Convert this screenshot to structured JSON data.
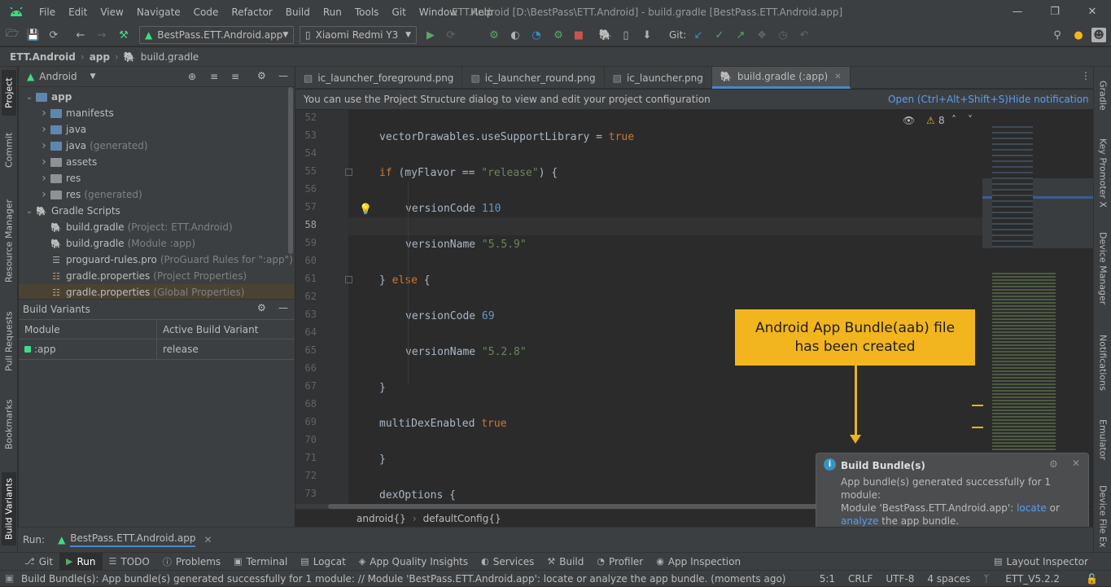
{
  "app_icon": "android-icon",
  "menu": [
    "File",
    "Edit",
    "View",
    "Navigate",
    "Code",
    "Refactor",
    "Build",
    "Run",
    "Tools",
    "Git",
    "Window",
    "Help"
  ],
  "window_title": "ETT.Android [D:\\BestPass\\ETT.Android] - build.gradle [BestPass.ETT.Android.app]",
  "toolbar": {
    "run_config": "BestPass.ETT.Android.app",
    "device": "Xiaomi Redmi Y3",
    "git_label": "Git:"
  },
  "breadcrumb": [
    "ETT.Android",
    "app",
    "build.gradle"
  ],
  "project_panel": {
    "view_mode": "Android",
    "tree": [
      {
        "label": "app",
        "sub": "",
        "level": 0,
        "icon": "folder",
        "open": true,
        "bold": true
      },
      {
        "label": "manifests",
        "sub": "",
        "level": 1,
        "icon": "folder",
        "open": false
      },
      {
        "label": "java",
        "sub": "",
        "level": 1,
        "icon": "folder",
        "open": false
      },
      {
        "label": "java",
        "sub": "(generated)",
        "level": 1,
        "icon": "folder",
        "open": false
      },
      {
        "label": "assets",
        "sub": "",
        "level": 1,
        "icon": "folder-gray",
        "open": false
      },
      {
        "label": "res",
        "sub": "",
        "level": 1,
        "icon": "folder-gray",
        "open": false
      },
      {
        "label": "res",
        "sub": "(generated)",
        "level": 1,
        "icon": "folder-gray",
        "open": false
      },
      {
        "label": "Gradle Scripts",
        "sub": "",
        "level": 0,
        "icon": "gradle",
        "open": true
      },
      {
        "label": "build.gradle",
        "sub": "(Project: ETT.Android)",
        "level": 1,
        "icon": "gradle",
        "open": null
      },
      {
        "label": "build.gradle",
        "sub": "(Module :app)",
        "level": 1,
        "icon": "gradle",
        "open": null
      },
      {
        "label": "proguard-rules.pro",
        "sub": "(ProGuard Rules for \":app\")",
        "level": 1,
        "icon": "file",
        "open": null
      },
      {
        "label": "gradle.properties",
        "sub": "(Project Properties)",
        "level": 1,
        "icon": "props",
        "open": null
      },
      {
        "label": "gradle.properties",
        "sub": "(Global Properties)",
        "level": 1,
        "icon": "props",
        "open": null
      }
    ]
  },
  "build_variants": {
    "title": "Build Variants",
    "col_module": "Module",
    "col_variant": "Active Build Variant",
    "rows": [
      {
        "module": ":app",
        "variant": "release"
      }
    ]
  },
  "left_stripe": [
    "Project",
    "Commit",
    "Resource Manager",
    "Pull Requests",
    "Bookmarks",
    "Build Variants"
  ],
  "right_stripe": [
    "Gradle",
    "Key Promoter X",
    "Device Manager",
    "Notifications",
    "Emulator",
    "Device File Ex"
  ],
  "editor_tabs": [
    {
      "label": "ic_launcher_foreground.png",
      "active": false
    },
    {
      "label": "ic_launcher_round.png",
      "active": false
    },
    {
      "label": "ic_launcher.png",
      "active": false
    },
    {
      "label": "build.gradle (:app)",
      "active": true
    }
  ],
  "notification_bar": {
    "text": "You can use the Project Structure dialog to view and edit your project configuration",
    "open_link": "Open (Ctrl+Alt+Shift+S)",
    "hide_link": "Hide notification"
  },
  "inspections": {
    "warnings": "8"
  },
  "code_lines": [
    {
      "n": "52",
      "indent": 0,
      "parts": []
    },
    {
      "n": "53",
      "indent": 1,
      "parts": [
        [
          "t",
          "vectorDrawables.useSupportLibrary = "
        ],
        [
          "k",
          "true"
        ]
      ]
    },
    {
      "n": "54",
      "indent": 0,
      "parts": []
    },
    {
      "n": "55",
      "indent": 1,
      "parts": [
        [
          "k",
          "if"
        ],
        [
          "t",
          " (myFlavor == "
        ],
        [
          "s",
          "\"release\""
        ],
        [
          "t",
          ") {"
        ]
      ]
    },
    {
      "n": "56",
      "indent": 0,
      "parts": []
    },
    {
      "n": "57",
      "indent": 2,
      "parts": [
        [
          "t",
          "versionCode "
        ],
        [
          "n",
          "110"
        ]
      ]
    },
    {
      "n": "58",
      "indent": 0,
      "parts": []
    },
    {
      "n": "59",
      "indent": 2,
      "parts": [
        [
          "t",
          "versionName "
        ],
        [
          "s",
          "\"5.5.9\""
        ]
      ]
    },
    {
      "n": "60",
      "indent": 0,
      "parts": []
    },
    {
      "n": "61",
      "indent": 1,
      "parts": [
        [
          "t",
          "} "
        ],
        [
          "k",
          "else"
        ],
        [
          "t",
          " {"
        ]
      ]
    },
    {
      "n": "62",
      "indent": 0,
      "parts": []
    },
    {
      "n": "63",
      "indent": 2,
      "parts": [
        [
          "t",
          "versionCode "
        ],
        [
          "n",
          "69"
        ]
      ]
    },
    {
      "n": "64",
      "indent": 0,
      "parts": []
    },
    {
      "n": "65",
      "indent": 2,
      "parts": [
        [
          "t",
          "versionName "
        ],
        [
          "s",
          "\"5.2.8\""
        ]
      ]
    },
    {
      "n": "66",
      "indent": 0,
      "parts": []
    },
    {
      "n": "67",
      "indent": 1,
      "parts": [
        [
          "t",
          "}"
        ]
      ]
    },
    {
      "n": "68",
      "indent": 0,
      "parts": []
    },
    {
      "n": "69",
      "indent": 1,
      "parts": [
        [
          "t",
          "multiDexEnabled "
        ],
        [
          "k",
          "true"
        ]
      ]
    },
    {
      "n": "70",
      "indent": 0,
      "parts": []
    },
    {
      "n": "71",
      "indent": 0,
      "parts": [
        [
          "t",
          "}"
        ]
      ]
    },
    {
      "n": "72",
      "indent": 0,
      "parts": []
    },
    {
      "n": "73",
      "indent": 0,
      "parts": [
        [
          "t",
          "dexOptions {"
        ]
      ]
    }
  ],
  "editor_footer": [
    "android{}",
    "defaultConfig{}"
  ],
  "callout": {
    "line1": "Android App Bundle(aab) file",
    "line2": "has been created"
  },
  "balloon": {
    "title": "Build Bundle(s)",
    "line1": "App bundle(s) generated successfully for 1",
    "line2": "module:",
    "line3_prefix": "Module 'BestPass.ETT.Android.app': ",
    "locate": "locate",
    "or": " or",
    "analyze": "analyze",
    "suffix": " the app bundle."
  },
  "run_bar": {
    "label": "Run:",
    "config": "BestPass.ETT.Android.app"
  },
  "tool_windows": [
    {
      "label": "Git",
      "icon": "git-icon",
      "active": false
    },
    {
      "label": "Run",
      "icon": "run-icon",
      "active": true
    },
    {
      "label": "TODO",
      "icon": "todo-icon",
      "active": false
    },
    {
      "label": "Problems",
      "icon": "problems-icon",
      "active": false
    },
    {
      "label": "Terminal",
      "icon": "terminal-icon",
      "active": false
    },
    {
      "label": "Logcat",
      "icon": "logcat-icon",
      "active": false
    },
    {
      "label": "App Quality Insights",
      "icon": "quality-icon",
      "active": false
    },
    {
      "label": "Services",
      "icon": "services-icon",
      "active": false
    },
    {
      "label": "Build",
      "icon": "build-icon",
      "active": false
    },
    {
      "label": "Profiler",
      "icon": "profiler-icon",
      "active": false
    },
    {
      "label": "App Inspection",
      "icon": "inspection-icon",
      "active": false
    }
  ],
  "layout_inspector": "Layout Inspector",
  "status": {
    "message": "Build Bundle(s): App bundle(s) generated successfully for 1 module: // Module 'BestPass.ETT.Android.app': locate or analyze the app bundle. (moments ago)",
    "position": "5:1",
    "line_sep": "CRLF",
    "encoding": "UTF-8",
    "indent": "4 spaces",
    "branch": "ETT_V5.2.2"
  },
  "colors": {
    "accent": "#4a88c7",
    "callout": "#f2b51d",
    "keyword": "#cc7832",
    "number": "#6897bb",
    "string": "#6a8759"
  }
}
